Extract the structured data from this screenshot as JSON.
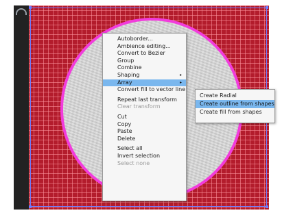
{
  "context_menu": {
    "items": [
      {
        "label": "Autoborder...",
        "enabled": true
      },
      {
        "label": "Ambience editing...",
        "enabled": true
      },
      {
        "label": "Convert to Bezier",
        "enabled": true
      },
      {
        "label": "Group",
        "enabled": true
      },
      {
        "label": "Combine",
        "enabled": true
      },
      {
        "label": "Shaping",
        "enabled": true,
        "submenu": true
      },
      {
        "label": "Array",
        "enabled": true,
        "submenu": true,
        "highlighted": true
      },
      {
        "label": "Convert fill to vector line",
        "enabled": true
      },
      {
        "label": "Repeat last transform",
        "enabled": true
      },
      {
        "label": "Clear transform",
        "enabled": false
      },
      {
        "label": "Cut",
        "enabled": true
      },
      {
        "label": "Copy",
        "enabled": true
      },
      {
        "label": "Paste",
        "enabled": true
      },
      {
        "label": "Delete",
        "enabled": true
      },
      {
        "label": "Select all",
        "enabled": true
      },
      {
        "label": "Invert selection",
        "enabled": true
      },
      {
        "label": "Select none",
        "enabled": false
      }
    ]
  },
  "array_submenu": {
    "items": [
      {
        "label": "Create Radial",
        "highlighted": false
      },
      {
        "label": "Create outline from shapes",
        "highlighted": true
      },
      {
        "label": "Create fill from shapes",
        "highlighted": false
      }
    ]
  },
  "colors": {
    "canvas_background": "#b31c2c",
    "circle_outline": "#f23cdc",
    "selection_frame": "#6d7cff",
    "menu_highlight": "#7ab7ee"
  },
  "icons": [
    "app-logo-icon",
    "submenu-arrow-icon"
  ]
}
